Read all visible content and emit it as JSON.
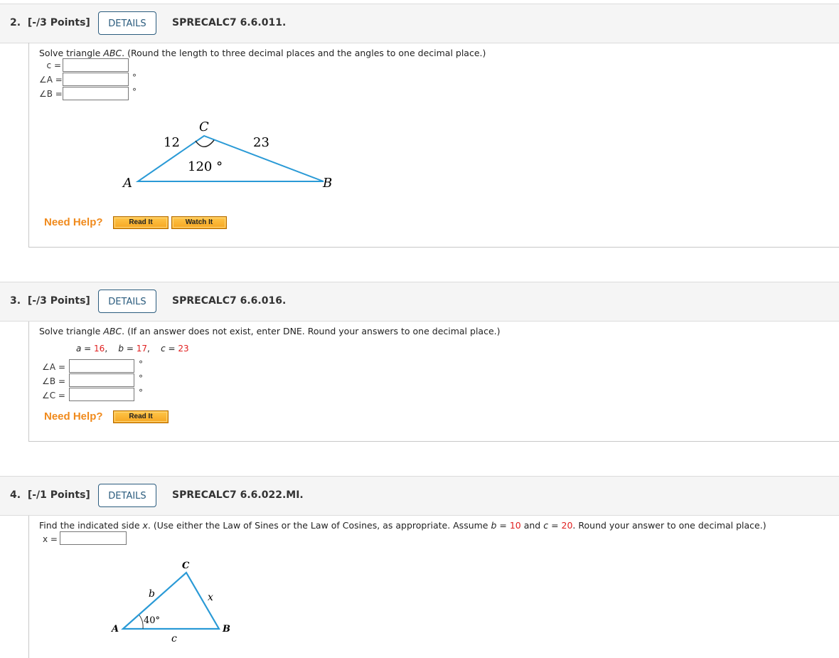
{
  "questions": [
    {
      "number": "2.",
      "points": "[-/3 Points]",
      "details_label": "DETAILS",
      "code": "SPRECALC7 6.6.011.",
      "prompt_pre": "Solve triangle ",
      "prompt_var": "ABC",
      "prompt_post": ". (Round the length to three decimal places and the angles to one decimal place.)",
      "fields": [
        {
          "label": "c =",
          "value": "",
          "unit": ""
        },
        {
          "label": "∠A =",
          "value": "",
          "unit": "°"
        },
        {
          "label": "∠B =",
          "value": "",
          "unit": "°"
        }
      ],
      "figure": {
        "vertices": {
          "A": "A",
          "B": "B",
          "C": "C"
        },
        "side_AC": "12",
        "side_CB": "23",
        "angle_C": "120 °",
        "line_color": "#2a9ad6"
      },
      "need_help": "Need Help?",
      "help_buttons": [
        "Read It",
        "Watch It"
      ]
    },
    {
      "number": "3.",
      "points": "[-/3 Points]",
      "details_label": "DETAILS",
      "code": "SPRECALC7 6.6.016.",
      "prompt_pre": "Solve triangle ",
      "prompt_var": "ABC",
      "prompt_post": ". (If an answer does not exist, enter DNE. Round your answers to one decimal place.)",
      "givens": [
        {
          "var": "a",
          "eq": " = ",
          "value": "16",
          "sep": ","
        },
        {
          "var": "b",
          "eq": " = ",
          "value": "17",
          "sep": ","
        },
        {
          "var": "c",
          "eq": " = ",
          "value": "23",
          "sep": ""
        }
      ],
      "fields": [
        {
          "label": "∠A =",
          "value": "",
          "unit": "°"
        },
        {
          "label": "∠B =",
          "value": "",
          "unit": "°"
        },
        {
          "label": "∠C =",
          "value": "",
          "unit": "°"
        }
      ],
      "need_help": "Need Help?",
      "help_buttons": [
        "Read It"
      ]
    },
    {
      "number": "4.",
      "points": "[-/1 Points]",
      "details_label": "DETAILS",
      "code": "SPRECALC7 6.6.022.MI.",
      "prompt_a": "Find the indicated side ",
      "prompt_x": "x",
      "prompt_b": ". (Use either the Law of Sines or the Law of Cosines, as appropriate. Assume ",
      "prompt_bvar": "b",
      "prompt_eq1": " = ",
      "prompt_bval": "10",
      "prompt_and": " and ",
      "prompt_cvar": "c",
      "prompt_eq2": " = ",
      "prompt_cval": "20",
      "prompt_end": ". Round your answer to one decimal place.)",
      "fields": [
        {
          "label": "x =",
          "value": "",
          "unit": ""
        }
      ],
      "figure": {
        "vertices": {
          "A": "A",
          "B": "B",
          "C": "C"
        },
        "side_b": "b",
        "side_x": "x",
        "side_c": "c",
        "angle_A": "40°",
        "line_color": "#2a9ad6"
      }
    }
  ]
}
